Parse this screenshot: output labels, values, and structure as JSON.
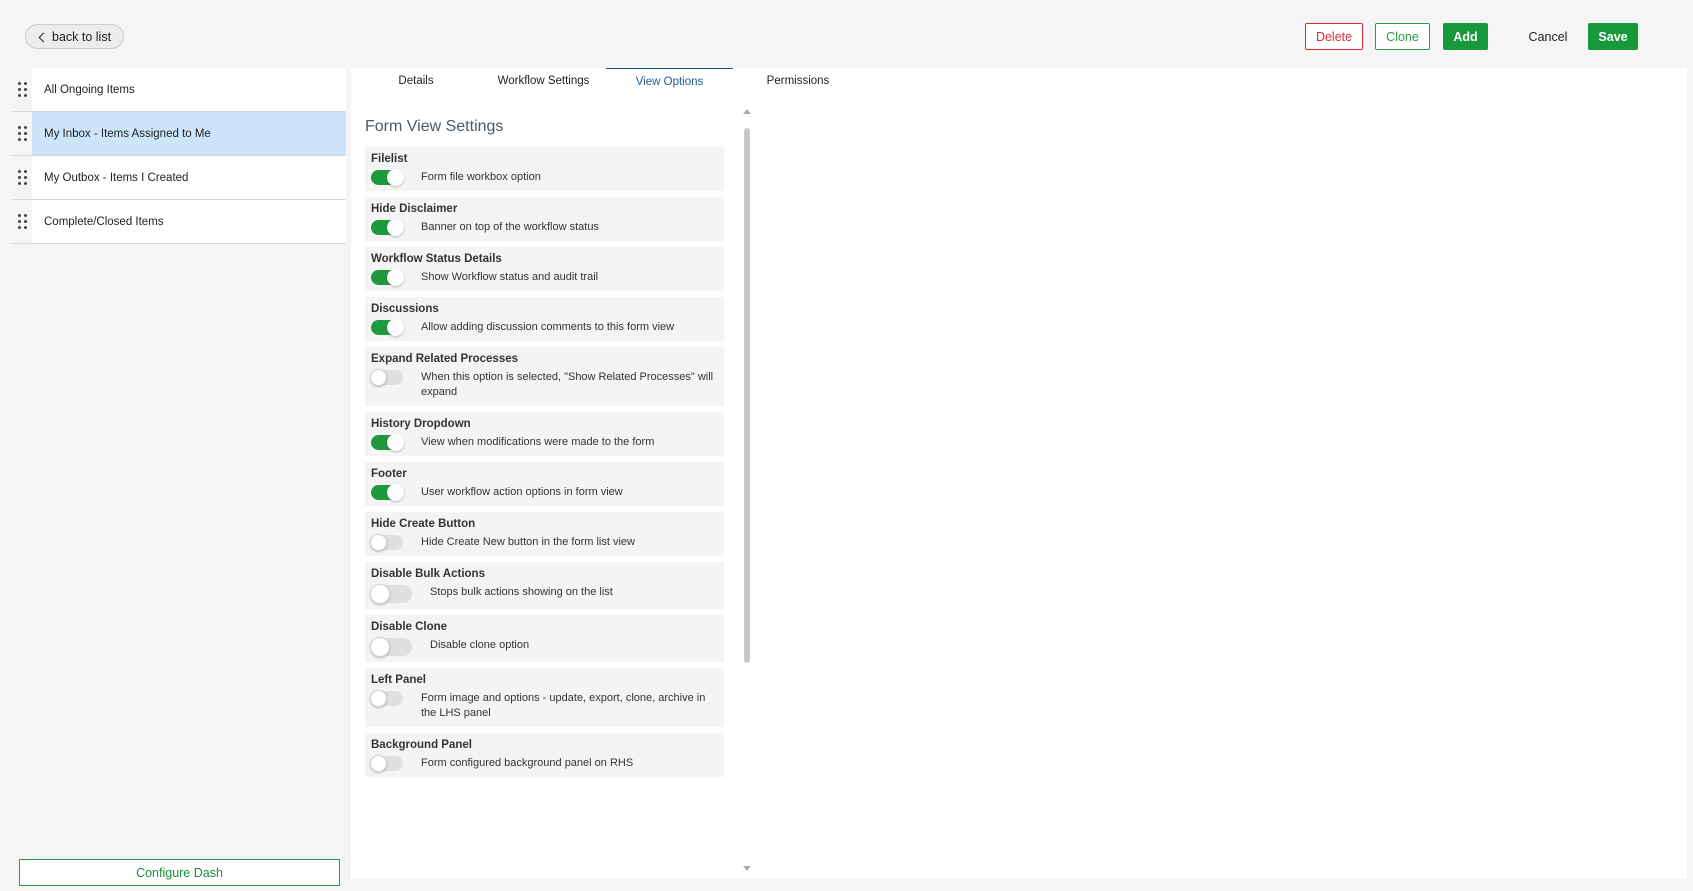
{
  "header": {
    "back_label": "back to list",
    "delete_label": "Delete",
    "clone_label": "Clone",
    "add_label": "Add",
    "cancel_label": "Cancel",
    "save_label": "Save"
  },
  "sidebar": {
    "items": [
      {
        "label": "All Ongoing Items"
      },
      {
        "label": "My Inbox - Items Assigned to Me",
        "active": true
      },
      {
        "label": "My Outbox - Items I Created"
      },
      {
        "label": "Complete/Closed Items"
      }
    ],
    "configure_label": "Configure Dash"
  },
  "tabs": [
    {
      "label": "Details"
    },
    {
      "label": "Workflow Settings"
    },
    {
      "label": "View Options",
      "active": true
    },
    {
      "label": "Permissions"
    }
  ],
  "form_view": {
    "title": "Form View Settings",
    "settings": [
      {
        "name": "Filelist",
        "desc": "Form file workbox option",
        "on": true
      },
      {
        "name": "Hide Disclaimer",
        "desc": "Banner on top of the workflow status",
        "on": true
      },
      {
        "name": "Workflow Status Details",
        "desc": "Show Workflow status and audit trail",
        "on": true
      },
      {
        "name": "Discussions",
        "desc": "Allow adding discussion comments to this form view",
        "on": true
      },
      {
        "name": "Expand Related Processes",
        "desc": "When this option is selected, \"Show Related Processes\" will expand",
        "on": false
      },
      {
        "name": "History Dropdown",
        "desc": "View when modifications were made to the form",
        "on": true
      },
      {
        "name": "Footer",
        "desc": "User workflow action options in form view",
        "on": true
      },
      {
        "name": "Hide Create Button",
        "desc": "Hide Create New button in the form list view",
        "on": false
      },
      {
        "name": "Disable Bulk Actions",
        "desc": "Stops bulk actions showing on the list",
        "on": false
      },
      {
        "name": "Disable Clone",
        "desc": "Disable clone option",
        "on": false
      },
      {
        "name": "Left Panel",
        "desc": "Form image and options - update, export, clone, archive in the LHS panel",
        "on": false
      },
      {
        "name": "Background Panel",
        "desc": "Form configured background panel on RHS",
        "on": false
      }
    ]
  },
  "colors": {
    "accent_green": "#17983a",
    "delete_red": "#d32f2f",
    "active_tab_blue": "#1d5a99",
    "active_row_bg": "#cde5fb"
  }
}
